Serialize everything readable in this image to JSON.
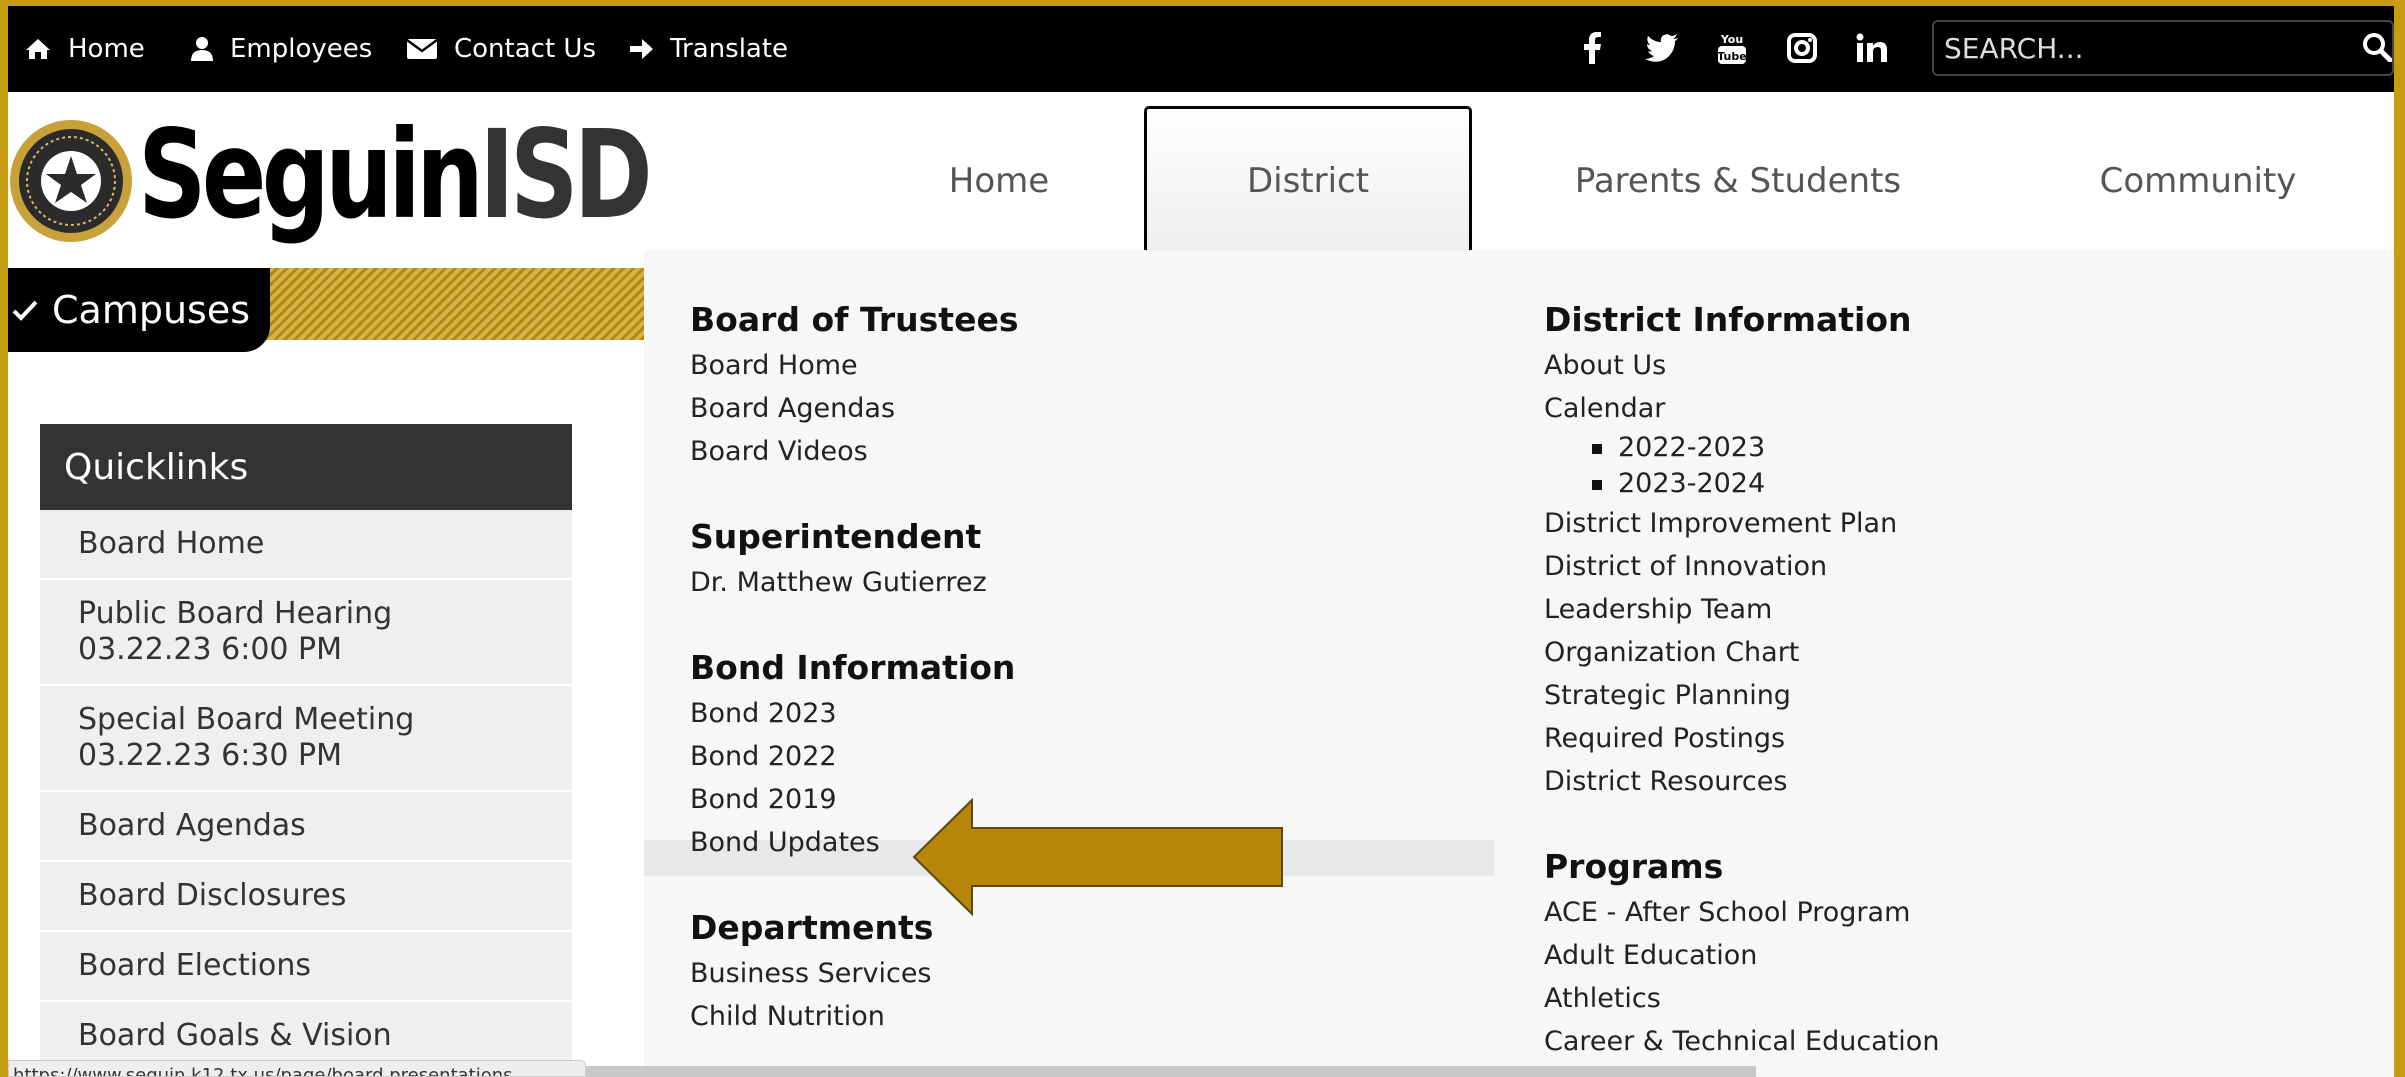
{
  "topbar": {
    "links": [
      {
        "label": "Home",
        "icon": "home-icon"
      },
      {
        "label": "Employees",
        "icon": "user-icon"
      },
      {
        "label": "Contact Us",
        "icon": "envelope-icon"
      },
      {
        "label": "Translate",
        "icon": "arrow-right-icon"
      }
    ],
    "social": [
      "facebook-icon",
      "twitter-icon",
      "youtube-icon",
      "instagram-icon",
      "linkedin-icon"
    ],
    "search": {
      "placeholder": "SEARCH..."
    }
  },
  "logo": {
    "part1": "Seguin",
    "part2": "ISD"
  },
  "nav": {
    "items": [
      "Home",
      "District",
      "Parents & Students",
      "Community"
    ],
    "active": "District"
  },
  "campuses_label": "Campuses",
  "quicklinks": {
    "title": "Quicklinks",
    "items": [
      {
        "line1": "Board Home",
        "line2": ""
      },
      {
        "line1": "Public Board Hearing",
        "line2": "03.22.23 6:00 PM"
      },
      {
        "line1": "Special Board Meeting",
        "line2": "03.22.23 6:30 PM"
      },
      {
        "line1": "Board Agendas",
        "line2": ""
      },
      {
        "line1": "Board Disclosures",
        "line2": ""
      },
      {
        "line1": "Board Elections",
        "line2": ""
      },
      {
        "line1": "Board Goals & Vision",
        "line2": ""
      }
    ]
  },
  "status_url": "https://www.seguin.k12.tx.us/page/board.presentations",
  "dropdown": {
    "left": {
      "board_title": "Board of Trustees",
      "board_links": [
        "Board Home",
        "Board Agendas",
        "Board Videos"
      ],
      "super_title": "Superintendent",
      "super_links": [
        "Dr. Matthew Gutierrez"
      ],
      "bond_title": "Bond Information",
      "bond_links": [
        "Bond 2023",
        "Bond 2022",
        "Bond 2019",
        "Bond Updates"
      ],
      "dept_title": "Departments",
      "dept_links": [
        "Business Services",
        "Child Nutrition"
      ]
    },
    "right": {
      "info_title": "District Information",
      "about": "About Us",
      "calendar": "Calendar",
      "calendar_years": [
        "2022-2023",
        "2023-2024"
      ],
      "info_links": [
        "District Improvement Plan",
        "District of Innovation",
        "Leadership Team",
        "Organization Chart",
        "Strategic Planning",
        "Required Postings",
        "District Resources"
      ],
      "programs_title": "Programs",
      "programs_links": [
        "ACE - After School Program",
        "Adult Education",
        "Athletics",
        "Career & Technical Education"
      ]
    }
  },
  "colors": {
    "gold": "#c79b12",
    "arrow": "#b8860b",
    "black": "#000000",
    "panel": "#f7f7f7"
  }
}
